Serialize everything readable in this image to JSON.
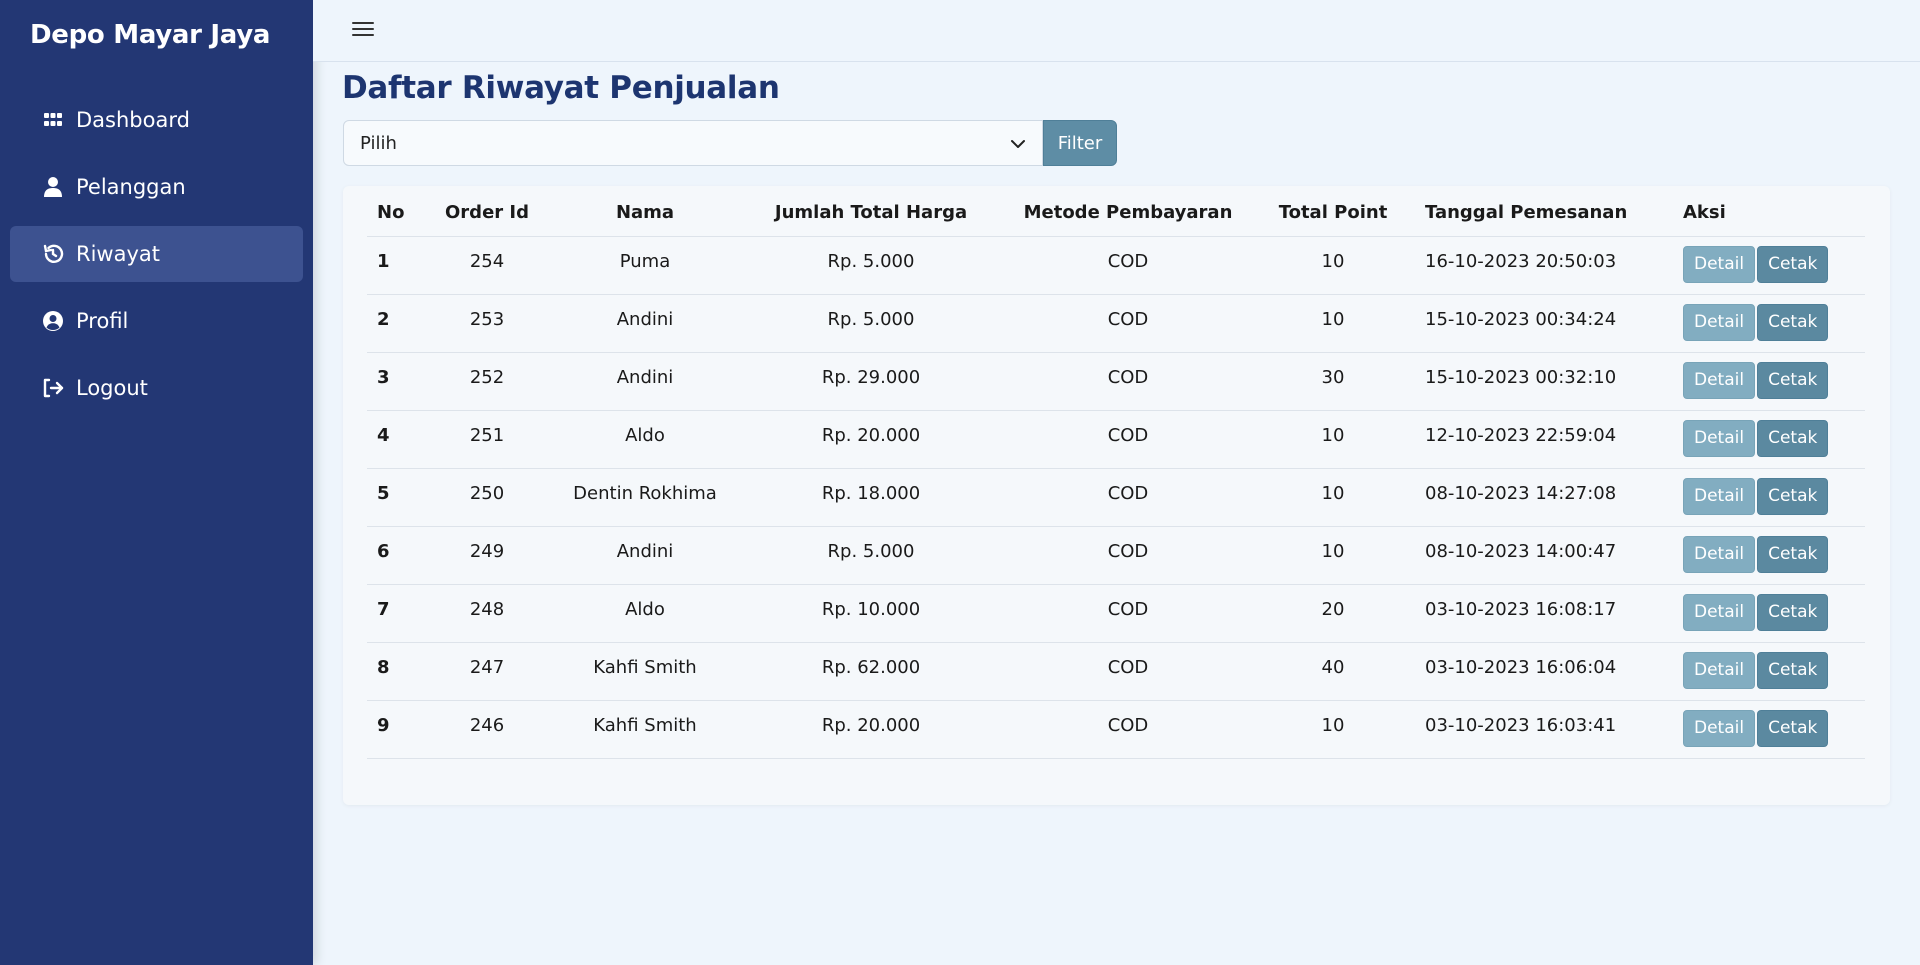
{
  "app": {
    "brand": "Depo Mayar Jaya"
  },
  "sidebar": {
    "items": [
      {
        "label": "Dashboard",
        "icon": "dashboard-grid-icon",
        "active": false
      },
      {
        "label": "Pelanggan",
        "icon": "user-icon",
        "active": false
      },
      {
        "label": "Riwayat",
        "icon": "history-icon",
        "active": true
      },
      {
        "label": "Profil",
        "icon": "user-circle-icon",
        "active": false
      },
      {
        "label": "Logout",
        "icon": "logout-icon",
        "active": false
      }
    ]
  },
  "topbar": {
    "menu_icon": "hamburger-icon"
  },
  "main": {
    "title": "Daftar Riwayat Penjualan",
    "filter": {
      "select_value": "Pilih",
      "button_label": "Filter"
    },
    "table": {
      "headers": [
        "No",
        "Order Id",
        "Nama",
        "Jumlah Total Harga",
        "Metode Pembayaran",
        "Total Point",
        "Tanggal Pemesanan",
        "Aksi"
      ],
      "rows": [
        {
          "no": "1",
          "order_id": "254",
          "nama": "Puma",
          "total": "Rp. 5.000",
          "metode": "COD",
          "point": "10",
          "tanggal": "16-10-2023 20:50:03"
        },
        {
          "no": "2",
          "order_id": "253",
          "nama": "Andini",
          "total": "Rp. 5.000",
          "metode": "COD",
          "point": "10",
          "tanggal": "15-10-2023 00:34:24"
        },
        {
          "no": "3",
          "order_id": "252",
          "nama": "Andini",
          "total": "Rp. 29.000",
          "metode": "COD",
          "point": "30",
          "tanggal": "15-10-2023 00:32:10"
        },
        {
          "no": "4",
          "order_id": "251",
          "nama": "Aldo",
          "total": "Rp. 20.000",
          "metode": "COD",
          "point": "10",
          "tanggal": "12-10-2023 22:59:04"
        },
        {
          "no": "5",
          "order_id": "250",
          "nama": "Dentin Rokhima",
          "total": "Rp. 18.000",
          "metode": "COD",
          "point": "10",
          "tanggal": "08-10-2023 14:27:08"
        },
        {
          "no": "6",
          "order_id": "249",
          "nama": "Andini",
          "total": "Rp. 5.000",
          "metode": "COD",
          "point": "10",
          "tanggal": "08-10-2023 14:00:47"
        },
        {
          "no": "7",
          "order_id": "248",
          "nama": "Aldo",
          "total": "Rp. 10.000",
          "metode": "COD",
          "point": "20",
          "tanggal": "03-10-2023 16:08:17"
        },
        {
          "no": "8",
          "order_id": "247",
          "nama": "Kahfi Smith",
          "total": "Rp. 62.000",
          "metode": "COD",
          "point": "40",
          "tanggal": "03-10-2023 16:06:04"
        },
        {
          "no": "9",
          "order_id": "246",
          "nama": "Kahfi Smith",
          "total": "Rp. 20.000",
          "metode": "COD",
          "point": "10",
          "tanggal": "03-10-2023 16:03:41"
        }
      ],
      "actions": {
        "detail_label": "Detail",
        "cetak_label": "Cetak"
      }
    }
  },
  "colors": {
    "sidebar_bg": "#233774",
    "sidebar_active": "#3d5290",
    "page_bg": "#eef5fc",
    "title": "#1d3570",
    "button_primary": "#5e8da5",
    "button_detail": "#82adc1"
  }
}
